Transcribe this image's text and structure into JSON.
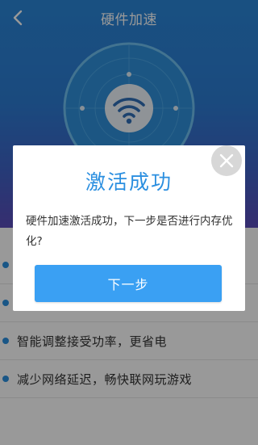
{
  "header": {
    "title": "硬件加速",
    "back_icon": "chevron-left-icon"
  },
  "hero": {
    "icon": "wifi-icon",
    "colors": {
      "top": "#2b86d8",
      "bottom": "#5b4cba"
    }
  },
  "features": [
    {
      "text": ""
    },
    {
      "text": ""
    },
    {
      "text": "智能调整接受功率，更省电"
    },
    {
      "text": "减少网络延迟，畅快联网玩游戏"
    }
  ],
  "dialog": {
    "title": "激活成功",
    "message": "硬件加速激活成功，下一步是否进行内存优化?",
    "button_label": "下一步",
    "close_icon": "close-icon",
    "accent": "#2b8fe0"
  }
}
